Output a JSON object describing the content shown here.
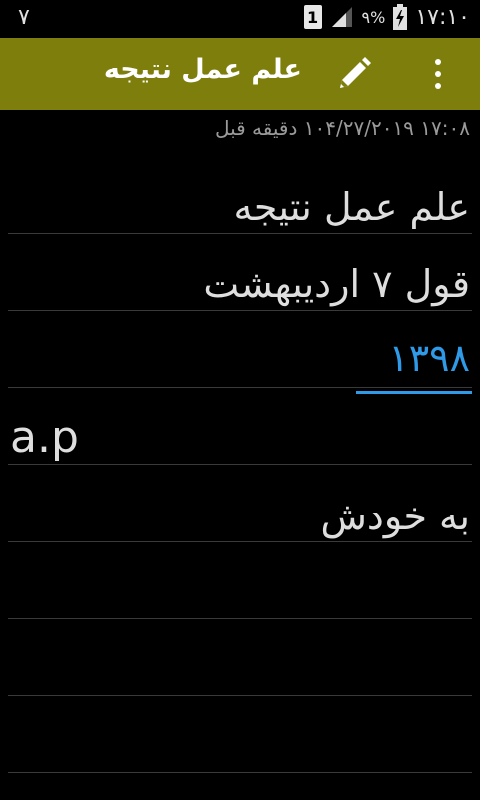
{
  "status_bar": {
    "left_value": "۷",
    "sim_label": "1",
    "battery_percent": "۹%",
    "time": "۱۷:۱۰"
  },
  "action_bar": {
    "title": "علم عمل نتیجه",
    "background_color": "#7e7e0c"
  },
  "note": {
    "timestamp": "۱۷:۰۸ ۱۰۴/۲۷/۲۰۱۹ دقیقه قبل",
    "lines": [
      "علم عمل نتیجه",
      "قول ۷ اردیبهشت",
      "۱۳۹۸",
      "a.p",
      "به خودش"
    ],
    "link_color": "#2f9be8"
  },
  "icons": {
    "menu": "overflow-menu-icon",
    "edit": "pencil-icon",
    "sim": "sim-card-icon",
    "signal": "signal-icon",
    "battery": "battery-charging-icon"
  }
}
